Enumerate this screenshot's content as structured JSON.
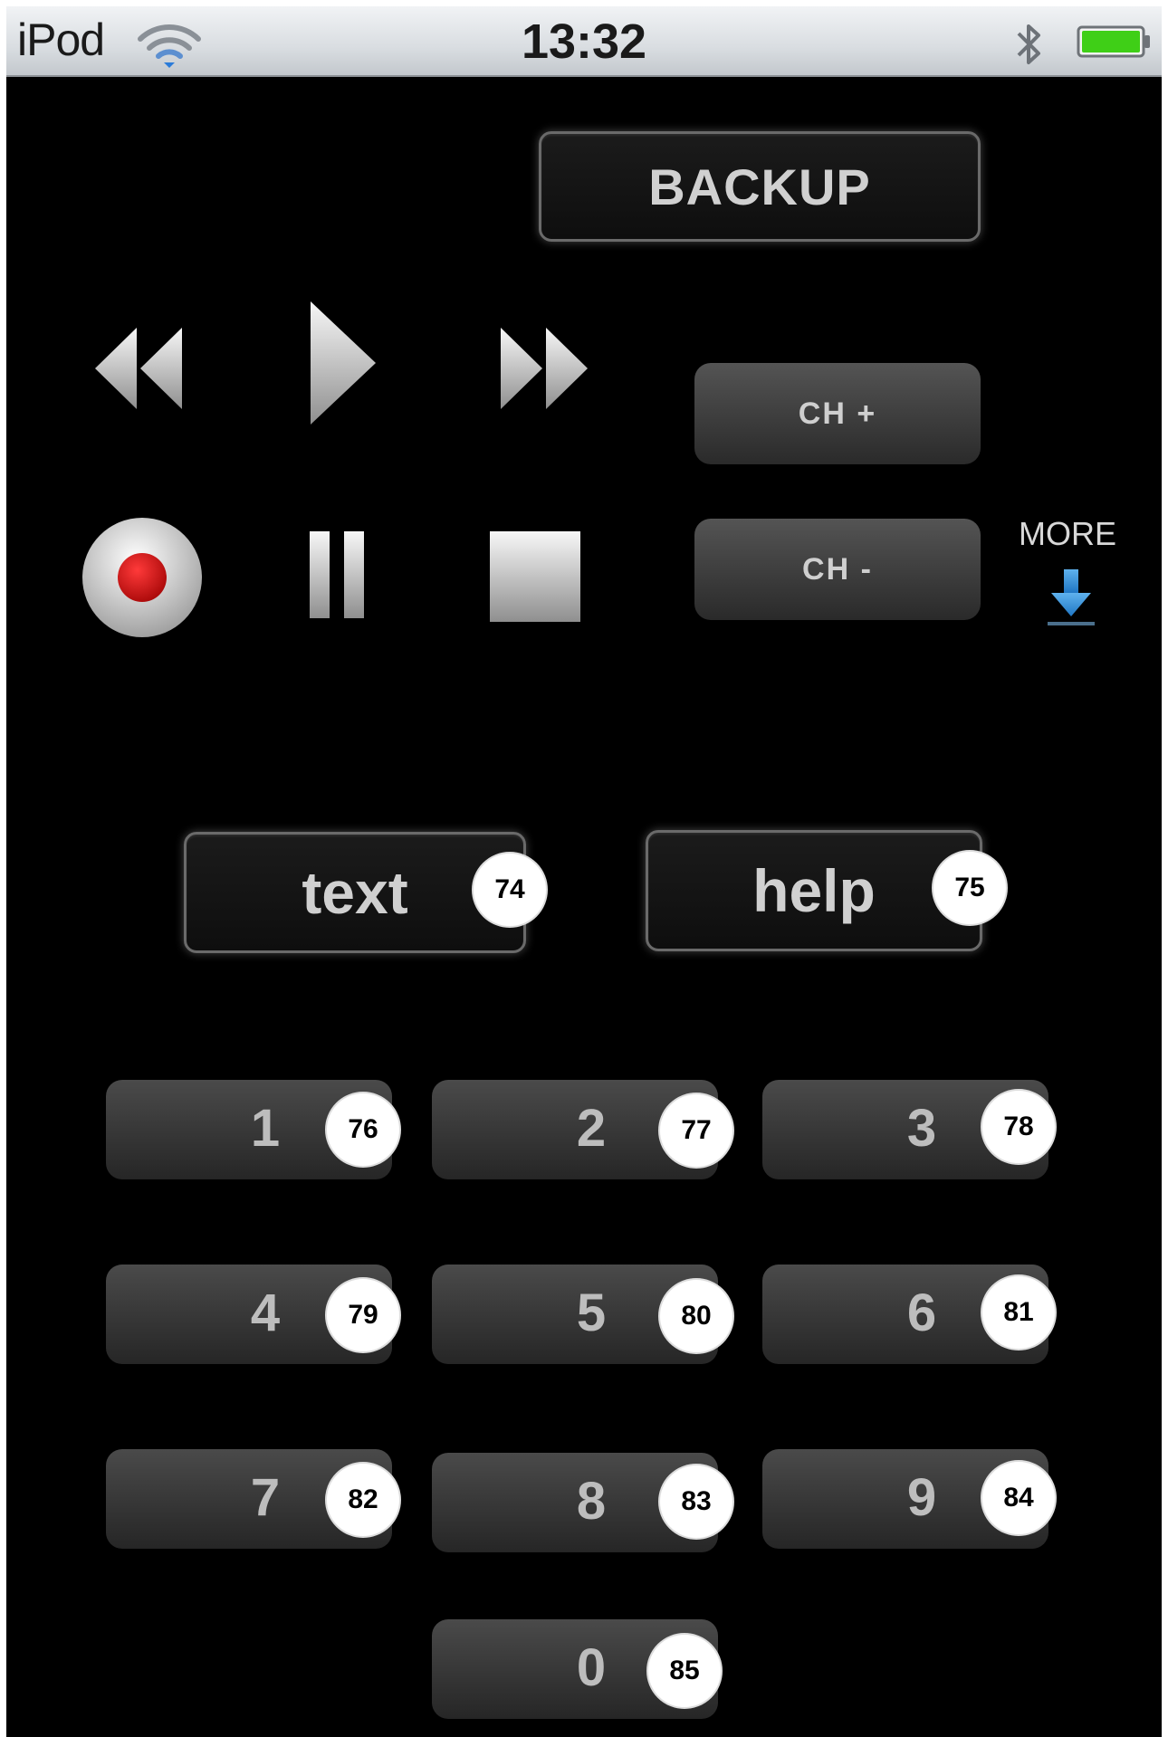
{
  "status_bar": {
    "carrier": "iPod",
    "time": "13:32"
  },
  "backup_button": {
    "label": "BACKUP"
  },
  "transport": {
    "rewind_icon": "rewind-icon",
    "play_icon": "play-icon",
    "fast_forward_icon": "fast-forward-icon",
    "record_icon": "record-icon",
    "pause_icon": "pause-icon",
    "stop_icon": "stop-icon"
  },
  "channel": {
    "up_label": "CH +",
    "down_label": "CH -"
  },
  "more": {
    "label": "MORE",
    "icon": "down-arrow-icon"
  },
  "function_buttons": [
    {
      "label": "text",
      "badge": "74"
    },
    {
      "label": "help",
      "badge": "75"
    }
  ],
  "keypad": [
    {
      "label": "1",
      "badge": "76"
    },
    {
      "label": "2",
      "badge": "77"
    },
    {
      "label": "3",
      "badge": "78"
    },
    {
      "label": "4",
      "badge": "79"
    },
    {
      "label": "5",
      "badge": "80"
    },
    {
      "label": "6",
      "badge": "81"
    },
    {
      "label": "7",
      "badge": "82"
    },
    {
      "label": "8",
      "badge": "83"
    },
    {
      "label": "9",
      "badge": "84"
    },
    {
      "label": "0",
      "badge": "85"
    }
  ],
  "colors": {
    "background": "#000000",
    "record_red": "#cc1111",
    "battery_green": "#3fcf17",
    "more_arrow_blue": "#2a8fd6",
    "wifi_blue": "#2a7bd9"
  }
}
